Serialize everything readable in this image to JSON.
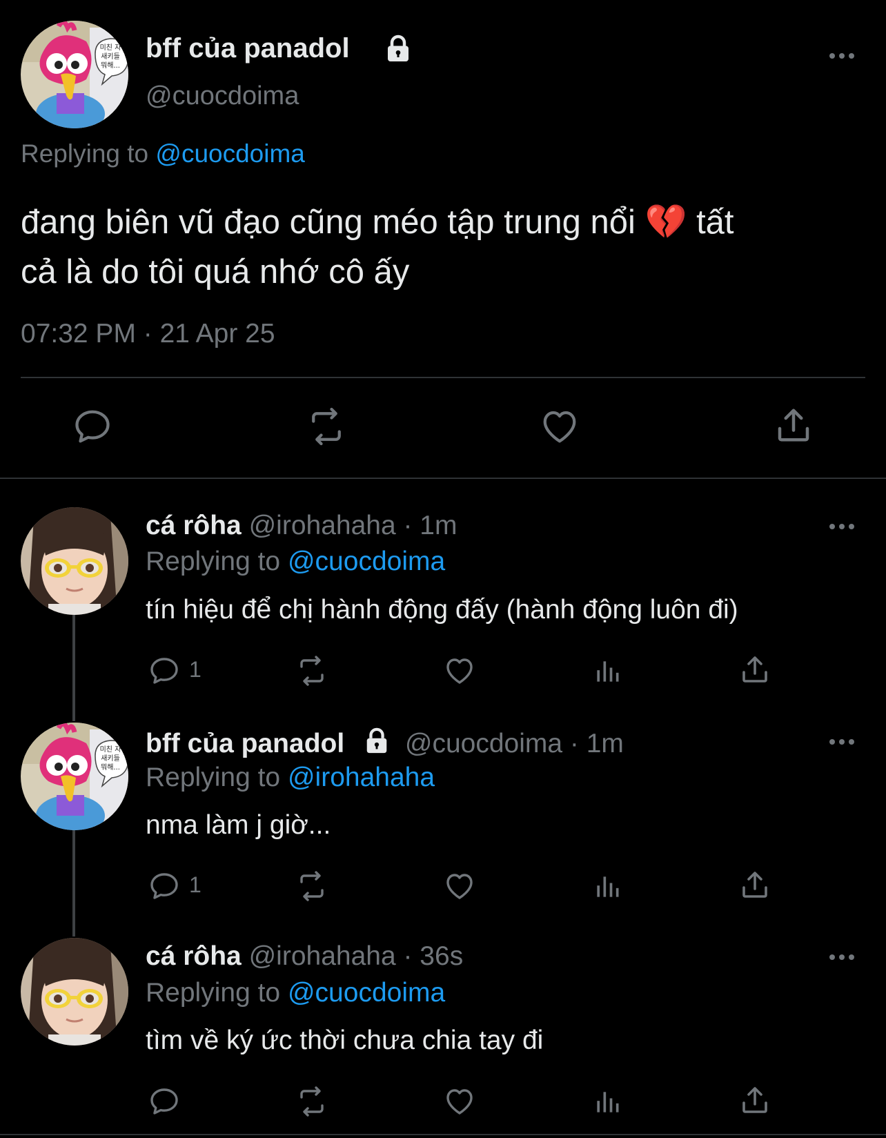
{
  "main_tweet": {
    "display_name": "bff của panadol",
    "handle": "@cuocdoima",
    "replying_label": "Replying to",
    "replying_to": "@cuocdoima",
    "text_line1": "đang biên vũ đạo cũng méo tập trung nổi 💔  tất",
    "text_line2": "cả là do tôi quá nhớ cô ấy",
    "timestamp": "07:32 PM · 21 Apr 25",
    "avatar_bubble": "미친 자\n새키들\n뭐해..."
  },
  "replies": [
    {
      "display_name": "cá rôha",
      "handle_time": "@irohahaha · 1m",
      "replying_label": "Replying to",
      "replying_to": "@cuocdoima",
      "text": "tín hiệu để chị hành động đấy (hành động luôn đi)",
      "reply_count": "1"
    },
    {
      "display_name": "bff của panadol",
      "handle_time": "@cuocdoima · 1m",
      "replying_label": "Replying to",
      "replying_to": "@irohahaha",
      "text": "nma làm j giờ...",
      "reply_count": "1"
    },
    {
      "display_name": "cá rôha",
      "handle_time": "@irohahaha · 36s",
      "replying_label": "Replying to",
      "replying_to": "@cuocdoima",
      "text": "tìm về ký ức thời chưa chia tay đi",
      "reply_count": ""
    }
  ],
  "icons": {
    "reply": "reply-icon",
    "retweet": "retweet-icon",
    "like": "heart-icon",
    "views": "views-icon",
    "share": "share-icon",
    "more": "more-icon",
    "lock": "lock-icon"
  },
  "colors": {
    "background": "#000000",
    "text": "#e7e9ea",
    "muted": "#71767b",
    "link": "#1d9bf0",
    "divider": "#2f3336"
  }
}
